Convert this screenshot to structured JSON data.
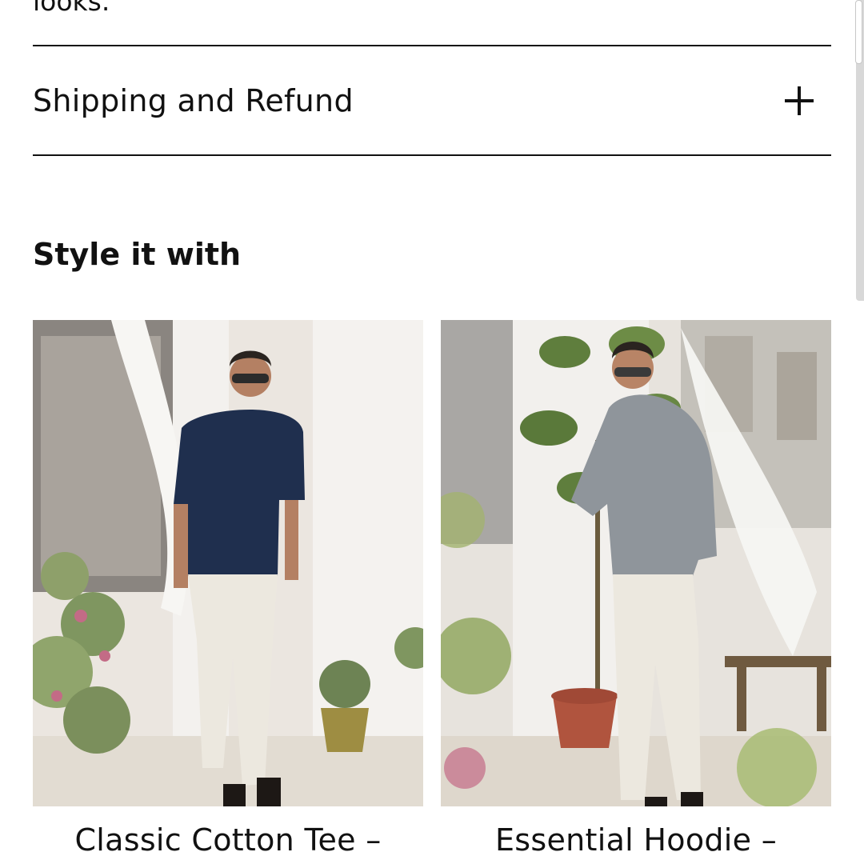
{
  "previous_section": {
    "text_fragment": "looks."
  },
  "accordion": {
    "label": "Shipping and Refund",
    "icon": "plus-icon"
  },
  "recommendations": {
    "title": "Style it with",
    "products": [
      {
        "name": "Classic Cotton Tee –",
        "image_icon": "product-photo",
        "colors": {
          "top": "#1f2f4e",
          "pants": "#ece8df"
        }
      },
      {
        "name": "Essential Hoodie –",
        "image_icon": "product-photo",
        "colors": {
          "top": "#8f959b",
          "pants": "#ece8df"
        }
      }
    ]
  },
  "colors": {
    "text": "#111111",
    "background": "#ffffff",
    "divider": "#111111"
  }
}
